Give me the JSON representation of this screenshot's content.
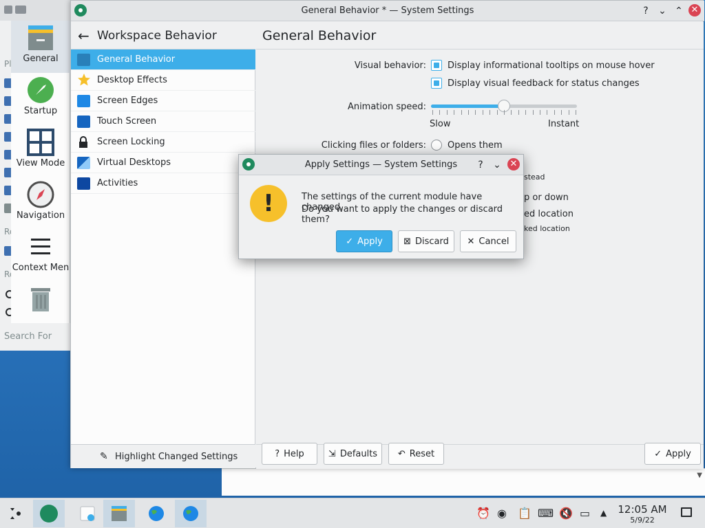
{
  "window": {
    "title": "General Behavior * — System Settings",
    "help_glyph": "?",
    "minimize_glyph": "⌄",
    "maximize_glyph": "⌃",
    "close_glyph": "✕"
  },
  "sidebar": {
    "back_glyph": "←",
    "heading": "Workspace Behavior",
    "items": [
      {
        "label": "General Behavior",
        "icon": "general-behavior-icon",
        "selected": true
      },
      {
        "label": "Desktop Effects",
        "icon": "star-icon"
      },
      {
        "label": "Screen Edges",
        "icon": "screen-edges-icon"
      },
      {
        "label": "Touch Screen",
        "icon": "touch-screen-icon"
      },
      {
        "label": "Screen Locking",
        "icon": "lock-icon"
      },
      {
        "label": "Virtual Desktops",
        "icon": "virtual-desktops-icon"
      },
      {
        "label": "Activities",
        "icon": "activities-icon"
      }
    ],
    "highlight_label": "Highlight Changed Settings"
  },
  "content": {
    "heading": "General Behavior",
    "visual_behavior_label": "Visual behavior:",
    "tooltips_label": "Display informational tooltips on mouse hover",
    "tooltips_checked": true,
    "feedback_label": "Display visual feedback for status changes",
    "feedback_checked": true,
    "animation_label": "Animation speed:",
    "animation_level": 0.5,
    "slider_min_label": "Slow",
    "slider_max_label": "Instant",
    "clicking_label": "Clicking files or folders:",
    "opens_them_label": "Opens them",
    "partial_text_1": "stead",
    "partial_text_2": "p or down",
    "partial_text_3": "ed location",
    "partial_text_4": "ked location"
  },
  "buttons": {
    "help": "Help",
    "defaults": "Defaults",
    "reset": "Reset",
    "apply": "Apply"
  },
  "dialog": {
    "title": "Apply Settings — System Settings",
    "message_line1": "The settings of the current module have changed.",
    "message_line2": "Do you want to apply the changes or discard them?",
    "apply": "Apply",
    "discard": "Discard",
    "cancel": "Cancel",
    "warning_glyph": "!"
  },
  "background_window": {
    "categories": [
      "General",
      "Startup",
      "View Mode",
      "Navigation",
      "Context Men"
    ],
    "search_label": "Search For",
    "partial_labels": [
      "Pl",
      "Re",
      "Re"
    ]
  },
  "taskbar": {
    "time": "12:05 AM",
    "date": "5/9/22"
  },
  "colors": {
    "accent": "#3daee9",
    "close": "#da4453",
    "warning": "#f6c02b"
  }
}
